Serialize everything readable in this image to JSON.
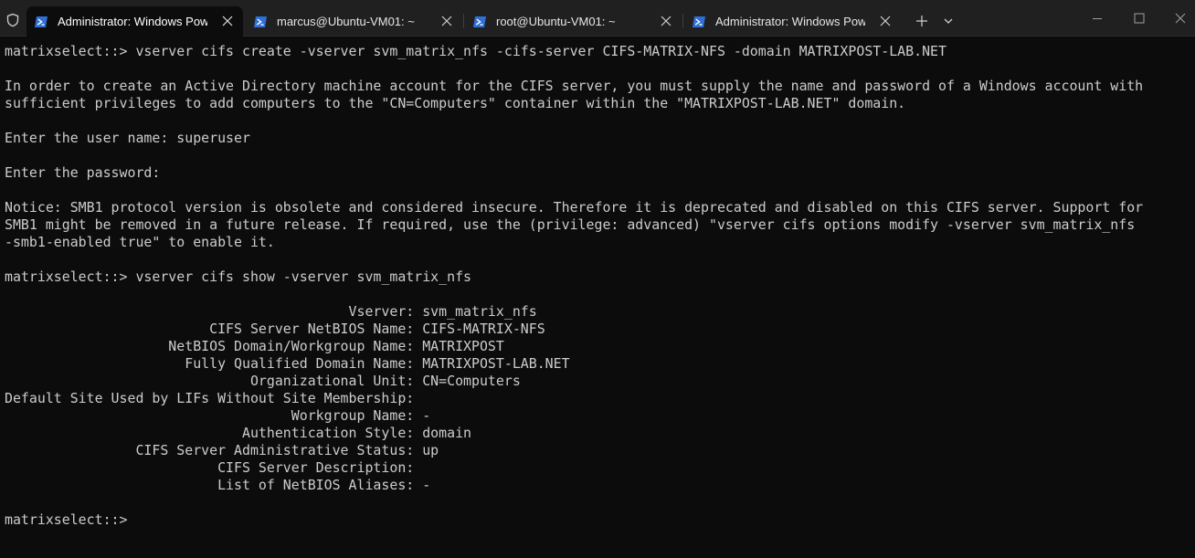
{
  "tabs": [
    {
      "label": "Administrator: Windows PowerShell",
      "icon": "powershell-icon",
      "active": true
    },
    {
      "label": "marcus@Ubuntu-VM01: ~",
      "icon": "powershell-icon",
      "active": false
    },
    {
      "label": "root@Ubuntu-VM01: ~",
      "icon": "powershell-icon",
      "active": false
    },
    {
      "label": "Administrator: Windows PowerShell",
      "icon": "powershell-icon",
      "active": false
    }
  ],
  "terminal": {
    "lines": [
      "matrixselect::> vserver cifs create -vserver svm_matrix_nfs -cifs-server CIFS-MATRIX-NFS -domain MATRIXPOST-LAB.NET",
      "",
      "In order to create an Active Directory machine account for the CIFS server, you must supply the name and password of a Windows account with",
      "sufficient privileges to add computers to the \"CN=Computers\" container within the \"MATRIXPOST-LAB.NET\" domain.",
      "",
      "Enter the user name: superuser",
      "",
      "Enter the password:",
      "",
      "Notice: SMB1 protocol version is obsolete and considered insecure. Therefore it is deprecated and disabled on this CIFS server. Support for",
      "SMB1 might be removed in a future release. If required, use the (privilege: advanced) \"vserver cifs options modify -vserver svm_matrix_nfs",
      "-smb1-enabled true\" to enable it.",
      "",
      "matrixselect::> vserver cifs show -vserver svm_matrix_nfs",
      "",
      "                                          Vserver: svm_matrix_nfs",
      "                         CIFS Server NetBIOS Name: CIFS-MATRIX-NFS",
      "                    NetBIOS Domain/Workgroup Name: MATRIXPOST",
      "                      Fully Qualified Domain Name: MATRIXPOST-LAB.NET",
      "                              Organizational Unit: CN=Computers",
      "Default Site Used by LIFs Without Site Membership:",
      "                                   Workgroup Name: -",
      "                             Authentication Style: domain",
      "                CIFS Server Administrative Status: up",
      "                          CIFS Server Description:",
      "                          List of NetBIOS Aliases: -",
      "",
      "matrixselect::>"
    ]
  }
}
